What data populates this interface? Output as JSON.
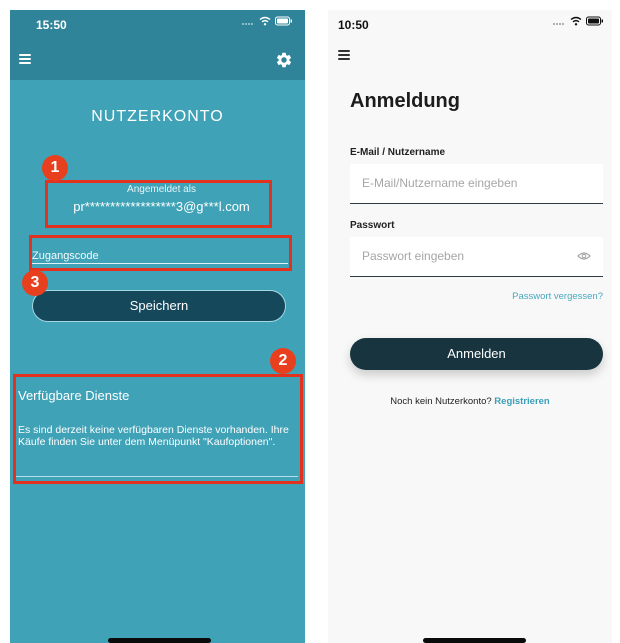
{
  "left_screen": {
    "status_time": "15:50",
    "title": "NUTZERKONTO",
    "logged_in_label": "Angemeldet als",
    "logged_in_email": "pr******************3@g***l.com",
    "access_code_placeholder": "Zugangscode",
    "save_label": "Speichern",
    "services_title": "Verfügbare Dienste",
    "services_text": "Es sind derzeit keine verfügbaren Dienste vorhanden. Ihre Käufe finden Sie unter dem Menüpunkt \"Kaufoptionen\".",
    "annotations": [
      "1",
      "2",
      "3"
    ],
    "colors": {
      "background": "#3fa2b7",
      "header": "#2f8499",
      "button": "#15485b",
      "annotation": "#e2321e"
    }
  },
  "right_screen": {
    "status_time": "10:50",
    "title": "Anmeldung",
    "email_label": "E-Mail / Nutzername",
    "email_placeholder": "E-Mail/Nutzername eingeben",
    "password_label": "Passwort",
    "password_placeholder": "Passwort eingeben",
    "forgot_password": "Passwort vergessen?",
    "login_label": "Anmelden",
    "no_account_text": "Noch kein Nutzerkonto?",
    "register_link": "Registrieren",
    "colors": {
      "background": "#f8f8f8",
      "button": "#17343f",
      "link": "#4aa8bf"
    }
  },
  "icons": [
    "menu-icon",
    "gear-icon",
    "wifi-icon",
    "battery-icon",
    "signal-icon",
    "eye-icon"
  ]
}
